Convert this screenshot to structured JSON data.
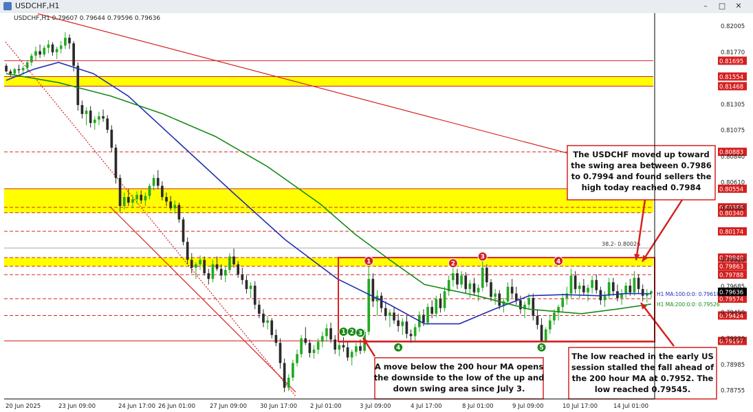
{
  "window": {
    "title": "USDCHF,H1",
    "min_glyph": "–",
    "max_glyph": "□",
    "close_glyph": "✕"
  },
  "chart_data": {
    "type": "candlestick",
    "symbol_info": "USDCHF,H1  0.79607 0.79644 0.79596 0.79636",
    "x_ticks": [
      "20 Jun 2025",
      "23 Jun 09:00",
      "24 Jun 17:00",
      "26 Jun 01:00",
      "27 Jun 09:00",
      "30 Jun 17:00",
      "2 Jul 01:00",
      "3 Jul 09:00",
      "4 Jul 17:00",
      "8 Jul 01:00",
      "9 Jul 09:00",
      "10 Jul 17:00",
      "14 Jul 01:00"
    ],
    "y_ticks": [
      0.82005,
      0.8177,
      0.81305,
      0.81075,
      0.8084,
      0.8061,
      0.8038,
      0.7992,
      0.79685,
      0.7945,
      0.7922,
      0.78985,
      0.78755
    ],
    "ylim": [
      0.7868,
      0.8212
    ],
    "current_price": 0.79636,
    "colors": {
      "up": "#22aa22",
      "down": "#2a2a2a",
      "ma100": "#1f2fb0",
      "ma200": "#168a16",
      "resistance": "#d42020",
      "zone": "#ffff00"
    },
    "horizontal_levels": [
      {
        "label": "0.81695",
        "value": 0.81695
      },
      {
        "label": "0.81554",
        "value": 0.81554
      },
      {
        "label": "0.81468",
        "value": 0.81468
      },
      {
        "label": "0.80883",
        "value": 0.80883
      },
      {
        "label": "0.80554",
        "value": 0.80554
      },
      {
        "label": "0.80388",
        "value": 0.80388
      },
      {
        "label": "0.80340",
        "value": 0.8034
      },
      {
        "label": "0.80174",
        "value": 0.80174
      },
      {
        "label": "0.79940",
        "value": 0.7994
      },
      {
        "label": "0.79863",
        "value": 0.79863
      },
      {
        "label": "0.79788",
        "value": 0.79788
      },
      {
        "label": "0.79574",
        "value": 0.79574
      },
      {
        "label": "0.79424",
        "value": 0.79424
      },
      {
        "label": "0.79197",
        "value": 0.79197
      }
    ],
    "zones": [
      {
        "from": 0.81468,
        "to": 0.81554
      },
      {
        "from": 0.8034,
        "to": 0.80554
      },
      {
        "from": 0.79863,
        "to": 0.7994
      }
    ],
    "fib_label": "38.2- 0.80026",
    "fib_value": 0.80026,
    "ma_labels": [
      {
        "text": "H1 MA:100:0:0: 0.79618",
        "value": 0.79618
      },
      {
        "text": "H1 MA:200:0:0: 0.79526",
        "value": 0.79526
      }
    ],
    "ma100": [
      [
        0,
        0.8152
      ],
      [
        8,
        0.8162
      ],
      [
        15,
        0.8168
      ],
      [
        25,
        0.8158
      ],
      [
        35,
        0.8138
      ],
      [
        50,
        0.8095
      ],
      [
        65,
        0.8052
      ],
      [
        80,
        0.801
      ],
      [
        95,
        0.7975
      ],
      [
        110,
        0.7952
      ],
      [
        120,
        0.7935
      ],
      [
        130,
        0.7935
      ],
      [
        140,
        0.7948
      ],
      [
        150,
        0.796
      ],
      [
        160,
        0.7961
      ],
      [
        170,
        0.796
      ],
      [
        178,
        0.7962
      ],
      [
        185,
        0.79618
      ]
    ],
    "ma200": [
      [
        0,
        0.8158
      ],
      [
        15,
        0.815
      ],
      [
        30,
        0.8138
      ],
      [
        45,
        0.8122
      ],
      [
        60,
        0.8102
      ],
      [
        75,
        0.8075
      ],
      [
        90,
        0.8042
      ],
      [
        100,
        0.8015
      ],
      [
        110,
        0.7992
      ],
      [
        120,
        0.797
      ],
      [
        135,
        0.796
      ],
      [
        150,
        0.7948
      ],
      [
        165,
        0.7944
      ],
      [
        175,
        0.7948
      ],
      [
        185,
        0.79526
      ]
    ],
    "candles": [
      [
        0,
        0.8165,
        0.8167,
        0.8159,
        0.816
      ],
      [
        1,
        0.816,
        0.8162,
        0.8155,
        0.8158
      ],
      [
        2,
        0.8158,
        0.8163,
        0.8156,
        0.8162
      ],
      [
        3,
        0.8162,
        0.8166,
        0.8158,
        0.8161
      ],
      [
        4,
        0.8161,
        0.8165,
        0.8157,
        0.8163
      ],
      [
        5,
        0.8163,
        0.817,
        0.816,
        0.8168
      ],
      [
        6,
        0.8168,
        0.8176,
        0.8165,
        0.8174
      ],
      [
        7,
        0.8174,
        0.8182,
        0.817,
        0.8178
      ],
      [
        8,
        0.8178,
        0.8184,
        0.8172,
        0.8175
      ],
      [
        9,
        0.8175,
        0.8183,
        0.8173,
        0.8181
      ],
      [
        10,
        0.8181,
        0.8188,
        0.8176,
        0.8184
      ],
      [
        11,
        0.8184,
        0.8186,
        0.8174,
        0.8177
      ],
      [
        12,
        0.8177,
        0.8182,
        0.8171,
        0.818
      ],
      [
        13,
        0.818,
        0.8187,
        0.8176,
        0.8183
      ],
      [
        14,
        0.8183,
        0.8195,
        0.818,
        0.819
      ],
      [
        15,
        0.819,
        0.8193,
        0.818,
        0.8185
      ],
      [
        16,
        0.8185,
        0.8187,
        0.816,
        0.8165
      ],
      [
        17,
        0.8165,
        0.8168,
        0.8125,
        0.813
      ],
      [
        18,
        0.813,
        0.8134,
        0.8118,
        0.8122
      ],
      [
        19,
        0.8122,
        0.8128,
        0.8112,
        0.8125
      ],
      [
        20,
        0.8125,
        0.8129,
        0.811,
        0.8114
      ],
      [
        21,
        0.8114,
        0.812,
        0.8108,
        0.8117
      ],
      [
        22,
        0.8117,
        0.8124,
        0.8112,
        0.812
      ],
      [
        23,
        0.812,
        0.8126,
        0.8115,
        0.8118
      ],
      [
        24,
        0.8118,
        0.8121,
        0.8105,
        0.8108
      ],
      [
        25,
        0.8108,
        0.8112,
        0.8088,
        0.8092
      ],
      [
        26,
        0.8092,
        0.8095,
        0.806,
        0.8065
      ],
      [
        27,
        0.8065,
        0.8068,
        0.8035,
        0.804
      ],
      [
        28,
        0.804,
        0.8052,
        0.8037,
        0.8048
      ],
      [
        29,
        0.8048,
        0.8055,
        0.804,
        0.8043
      ],
      [
        30,
        0.8043,
        0.805,
        0.8038,
        0.8046
      ],
      [
        31,
        0.8046,
        0.8053,
        0.8042,
        0.805
      ],
      [
        32,
        0.805,
        0.8054,
        0.8042,
        0.8045
      ],
      [
        33,
        0.8045,
        0.8052,
        0.804,
        0.8049
      ],
      [
        34,
        0.8049,
        0.806,
        0.8046,
        0.8058
      ],
      [
        35,
        0.8058,
        0.8068,
        0.8054,
        0.8065
      ],
      [
        36,
        0.8065,
        0.8072,
        0.8055,
        0.8058
      ],
      [
        37,
        0.8058,
        0.8062,
        0.8045,
        0.8048
      ],
      [
        38,
        0.8048,
        0.8052,
        0.804,
        0.8044
      ],
      [
        39,
        0.8044,
        0.8049,
        0.8036,
        0.8038
      ],
      [
        40,
        0.8038,
        0.8045,
        0.8033,
        0.8041
      ],
      [
        41,
        0.8041,
        0.8043,
        0.8025,
        0.8028
      ],
      [
        42,
        0.8028,
        0.803,
        0.8005,
        0.8008
      ],
      [
        43,
        0.8008,
        0.8012,
        0.7988,
        0.7992
      ],
      [
        44,
        0.7992,
        0.7998,
        0.798,
        0.7985
      ],
      [
        45,
        0.7985,
        0.799,
        0.7975,
        0.7988
      ],
      [
        46,
        0.7988,
        0.7996,
        0.7983,
        0.7992
      ],
      [
        47,
        0.7992,
        0.7995,
        0.7978,
        0.798
      ],
      [
        48,
        0.798,
        0.7984,
        0.797,
        0.7975
      ],
      [
        49,
        0.7975,
        0.7992,
        0.7972,
        0.7988
      ],
      [
        50,
        0.7988,
        0.7995,
        0.7982,
        0.7984
      ],
      [
        51,
        0.7984,
        0.7988,
        0.7974,
        0.7978
      ],
      [
        52,
        0.7978,
        0.7986,
        0.7972,
        0.7983
      ],
      [
        53,
        0.7983,
        0.7998,
        0.798,
        0.7995
      ],
      [
        54,
        0.7995,
        0.8002,
        0.7985,
        0.7988
      ],
      [
        55,
        0.7988,
        0.7991,
        0.7976,
        0.7979
      ],
      [
        56,
        0.7979,
        0.7985,
        0.797,
        0.7974
      ],
      [
        57,
        0.7974,
        0.7978,
        0.7962,
        0.7966
      ],
      [
        58,
        0.7966,
        0.7972,
        0.7958,
        0.7969
      ],
      [
        59,
        0.7969,
        0.7973,
        0.7948,
        0.7952
      ],
      [
        60,
        0.7952,
        0.7956,
        0.794,
        0.7944
      ],
      [
        61,
        0.7944,
        0.7948,
        0.7932,
        0.7936
      ],
      [
        62,
        0.7936,
        0.7942,
        0.793,
        0.7938
      ],
      [
        63,
        0.7938,
        0.794,
        0.7922,
        0.7925
      ],
      [
        64,
        0.7925,
        0.793,
        0.7915,
        0.7918
      ],
      [
        65,
        0.7918,
        0.7922,
        0.7895,
        0.79
      ],
      [
        66,
        0.79,
        0.7904,
        0.7874,
        0.7878
      ],
      [
        67,
        0.7878,
        0.789,
        0.7875,
        0.7887
      ],
      [
        68,
        0.7887,
        0.7903,
        0.7884,
        0.79
      ],
      [
        69,
        0.79,
        0.7912,
        0.7897,
        0.7908
      ],
      [
        70,
        0.7908,
        0.7925,
        0.7905,
        0.7922
      ],
      [
        71,
        0.7922,
        0.7932,
        0.7916,
        0.7918
      ],
      [
        72,
        0.7918,
        0.7921,
        0.7905,
        0.7909
      ],
      [
        73,
        0.7909,
        0.7916,
        0.7904,
        0.7912
      ],
      [
        74,
        0.7912,
        0.7922,
        0.7908,
        0.7919
      ],
      [
        75,
        0.7919,
        0.7928,
        0.7914,
        0.7924
      ],
      [
        76,
        0.7924,
        0.7935,
        0.7919,
        0.7931
      ],
      [
        77,
        0.7931,
        0.7936,
        0.7918,
        0.7921
      ],
      [
        78,
        0.7921,
        0.7925,
        0.7908,
        0.7912
      ],
      [
        79,
        0.7912,
        0.7918,
        0.7906,
        0.7916
      ],
      [
        80,
        0.7916,
        0.7923,
        0.791,
        0.7914
      ],
      [
        81,
        0.7914,
        0.7919,
        0.7902,
        0.7905
      ],
      [
        82,
        0.7905,
        0.7912,
        0.7898,
        0.791
      ],
      [
        83,
        0.791,
        0.7918,
        0.7906,
        0.7915
      ],
      [
        84,
        0.7915,
        0.7921,
        0.7908,
        0.7911
      ],
      [
        85,
        0.7911,
        0.793,
        0.7909,
        0.7928
      ],
      [
        86,
        0.7928,
        0.7988,
        0.7925,
        0.7975
      ],
      [
        87,
        0.7975,
        0.798,
        0.795,
        0.7955
      ],
      [
        88,
        0.7955,
        0.7965,
        0.7942,
        0.796
      ],
      [
        89,
        0.796,
        0.7963,
        0.7945,
        0.7949
      ],
      [
        90,
        0.7949,
        0.7955,
        0.7938,
        0.7942
      ],
      [
        91,
        0.7942,
        0.7948,
        0.7932,
        0.7945
      ],
      [
        92,
        0.7945,
        0.795,
        0.7935,
        0.7938
      ],
      [
        93,
        0.7938,
        0.7944,
        0.7928,
        0.7933
      ],
      [
        94,
        0.7933,
        0.794,
        0.7925,
        0.7937
      ],
      [
        95,
        0.7937,
        0.7942,
        0.7922,
        0.7926
      ],
      [
        96,
        0.7926,
        0.793,
        0.7918,
        0.7924
      ],
      [
        97,
        0.7924,
        0.7935,
        0.792,
        0.7932
      ],
      [
        98,
        0.7932,
        0.7946,
        0.7928,
        0.7943
      ],
      [
        99,
        0.7943,
        0.7948,
        0.7933,
        0.7936
      ],
      [
        100,
        0.7936,
        0.7953,
        0.7934,
        0.795
      ],
      [
        101,
        0.795,
        0.7956,
        0.794,
        0.7944
      ],
      [
        102,
        0.7944,
        0.796,
        0.7941,
        0.7957
      ],
      [
        103,
        0.7957,
        0.7962,
        0.7945,
        0.7949
      ],
      [
        104,
        0.7949,
        0.7968,
        0.7946,
        0.7964
      ],
      [
        105,
        0.7964,
        0.7978,
        0.796,
        0.7974
      ],
      [
        106,
        0.7974,
        0.7986,
        0.7968,
        0.798
      ],
      [
        107,
        0.798,
        0.7984,
        0.7966,
        0.797
      ],
      [
        108,
        0.797,
        0.7982,
        0.7967,
        0.7978
      ],
      [
        109,
        0.7978,
        0.7981,
        0.7962,
        0.7966
      ],
      [
        110,
        0.7966,
        0.7974,
        0.7958,
        0.7971
      ],
      [
        111,
        0.7971,
        0.7976,
        0.796,
        0.7963
      ],
      [
        112,
        0.7963,
        0.797,
        0.7955,
        0.7967
      ],
      [
        113,
        0.7967,
        0.7992,
        0.7964,
        0.7985
      ],
      [
        114,
        0.7985,
        0.7988,
        0.7968,
        0.7972
      ],
      [
        115,
        0.7972,
        0.7975,
        0.7955,
        0.7959
      ],
      [
        116,
        0.7959,
        0.7966,
        0.7952,
        0.7962
      ],
      [
        117,
        0.7962,
        0.7965,
        0.7948,
        0.7951
      ],
      [
        118,
        0.7951,
        0.7958,
        0.7945,
        0.7955
      ],
      [
        119,
        0.7955,
        0.7972,
        0.7952,
        0.7968
      ],
      [
        120,
        0.7968,
        0.7975,
        0.7958,
        0.7962
      ],
      [
        121,
        0.7962,
        0.7968,
        0.7952,
        0.7956
      ],
      [
        122,
        0.7956,
        0.796,
        0.7944,
        0.7948
      ],
      [
        123,
        0.7948,
        0.7955,
        0.794,
        0.7952
      ],
      [
        124,
        0.7952,
        0.7962,
        0.7948,
        0.7958
      ],
      [
        125,
        0.7958,
        0.7962,
        0.7938,
        0.7942
      ],
      [
        126,
        0.7942,
        0.7948,
        0.793,
        0.7934
      ],
      [
        127,
        0.7934,
        0.794,
        0.7917,
        0.792
      ],
      [
        128,
        0.792,
        0.7932,
        0.7918,
        0.793
      ],
      [
        129,
        0.793,
        0.7942,
        0.7926,
        0.7938
      ],
      [
        130,
        0.7938,
        0.7948,
        0.7934,
        0.7945
      ],
      [
        131,
        0.7945,
        0.7952,
        0.7938,
        0.795
      ],
      [
        132,
        0.795,
        0.7962,
        0.7946,
        0.7958
      ],
      [
        133,
        0.7958,
        0.7968,
        0.7952,
        0.7962
      ],
      [
        134,
        0.7962,
        0.7984,
        0.7958,
        0.7978
      ],
      [
        135,
        0.7978,
        0.7982,
        0.7962,
        0.7966
      ],
      [
        136,
        0.7966,
        0.7972,
        0.7958,
        0.7969
      ],
      [
        137,
        0.7969,
        0.7975,
        0.796,
        0.7963
      ],
      [
        138,
        0.7963,
        0.797,
        0.7955,
        0.7967
      ],
      [
        139,
        0.7967,
        0.7978,
        0.7962,
        0.7974
      ],
      [
        140,
        0.7974,
        0.7979,
        0.7962,
        0.7965
      ],
      [
        141,
        0.7965,
        0.7968,
        0.7952,
        0.7956
      ],
      [
        142,
        0.7956,
        0.7964,
        0.795,
        0.796
      ],
      [
        143,
        0.796,
        0.7976,
        0.7957,
        0.7972
      ],
      [
        144,
        0.7972,
        0.7976,
        0.796,
        0.7964
      ],
      [
        145,
        0.7964,
        0.797,
        0.7955,
        0.7958
      ],
      [
        146,
        0.7958,
        0.7966,
        0.7952,
        0.7962
      ],
      [
        147,
        0.7962,
        0.7972,
        0.7958,
        0.7969
      ],
      [
        148,
        0.7969,
        0.7975,
        0.796,
        0.7963
      ],
      [
        149,
        0.7963,
        0.7982,
        0.796,
        0.7976
      ],
      [
        150,
        0.7976,
        0.7979,
        0.7962,
        0.7966
      ],
      [
        151,
        0.7966,
        0.797,
        0.7955,
        0.796
      ],
      [
        152,
        0.796,
        0.7966,
        0.7954,
        0.7962
      ],
      [
        153,
        0.7962,
        0.7965,
        0.7958,
        0.7964
      ]
    ],
    "markers": [
      {
        "label": "1",
        "i": 86,
        "value": 0.7991,
        "color": "#d42020"
      },
      {
        "label": "2",
        "i": 106,
        "value": 0.7989,
        "color": "#d42020"
      },
      {
        "label": "3",
        "i": 113,
        "value": 0.7995,
        "color": "#d42020"
      },
      {
        "label": "4",
        "i": 131,
        "value": 0.7991,
        "color": "#d42020"
      },
      {
        "label": "1",
        "i": 80,
        "value": 0.7928,
        "color": "#168a16"
      },
      {
        "label": "2",
        "i": 82,
        "value": 0.7928,
        "color": "#168a16"
      },
      {
        "label": "3",
        "i": 84,
        "value": 0.7927,
        "color": "#168a16"
      },
      {
        "label": "4",
        "i": 93,
        "value": 0.7914,
        "color": "#168a16"
      },
      {
        "label": "5",
        "i": 127,
        "value": 0.7914,
        "color": "#168a16"
      }
    ],
    "annotations": {
      "top": [
        "The USDCHF moved up toward",
        "the swing area between 0.7986",
        "to 0.7994 and found sellers the",
        "high today reached 0.7984"
      ],
      "middle": [
        "A move below the 200 hour MA opens",
        "the downside to the low of the up and",
        "down swing area since July 3."
      ],
      "bottom": [
        "The low reached in the early US",
        "session stalled the fall ahead of",
        "the 200 hour MA at 0.7952. The",
        "low reached 0.79545."
      ]
    }
  }
}
